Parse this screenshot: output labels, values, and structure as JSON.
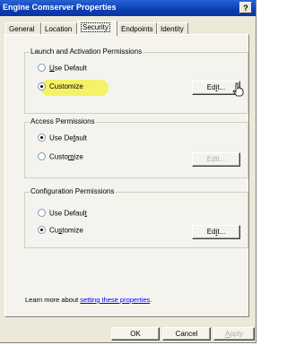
{
  "window": {
    "title": "Engine Comserver Properties",
    "help_label": "?"
  },
  "tabs": [
    {
      "label": "General",
      "active": false
    },
    {
      "label": "Location",
      "active": false
    },
    {
      "label": "Security",
      "active": true
    },
    {
      "label": "Endpoints",
      "active": false
    },
    {
      "label": "Identity",
      "active": false
    }
  ],
  "groups": {
    "launch": {
      "title": "Launch and Activation Permissions",
      "use_default": {
        "pre": "",
        "key": "U",
        "post": "se Default",
        "checked": false
      },
      "customize": {
        "pre": "",
        "key": "",
        "post": "Customize",
        "checked": true
      },
      "edit": {
        "pre": "Ed",
        "key": "i",
        "post": "t...",
        "disabled": false
      }
    },
    "access": {
      "title": "Access Permissions",
      "use_default": {
        "pre": "Use De",
        "key": "f",
        "post": "ault",
        "checked": true
      },
      "customize": {
        "pre": "Custo",
        "key": "m",
        "post": "ize",
        "checked": false
      },
      "edit": {
        "pre": "Edit...",
        "key": "",
        "post": "",
        "disabled": true
      }
    },
    "config": {
      "title": "Configuration Permissions",
      "use_default": {
        "pre": "Use Defaul",
        "key": "t",
        "post": "",
        "checked": false
      },
      "customize": {
        "pre": "Cu",
        "key": "s",
        "post": "tomize",
        "checked": true
      },
      "edit": {
        "pre": "Ed",
        "key": "i",
        "post": "t...",
        "disabled": false
      }
    }
  },
  "learn_more": {
    "text": "Learn more about ",
    "link": "setting these properties",
    "suffix": "."
  },
  "footer": {
    "ok": "OK",
    "cancel": "Cancel",
    "apply_pre": "",
    "apply_key": "A",
    "apply_post": "pply"
  },
  "colors": {
    "title_bar": "#0a3fb3",
    "highlight": "#f5f23a",
    "link": "#0000ff"
  }
}
